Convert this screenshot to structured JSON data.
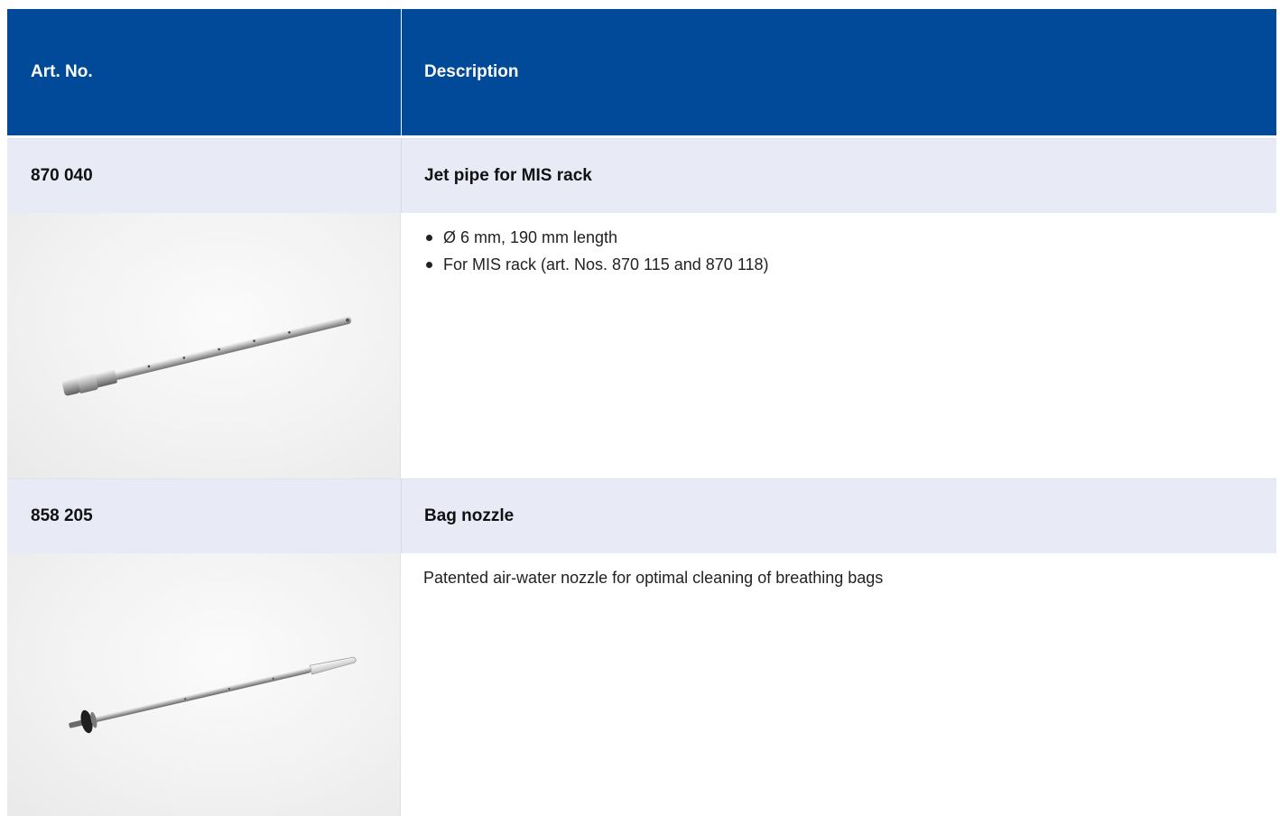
{
  "header": {
    "col_art": "Art. No.",
    "col_desc": "Description"
  },
  "products": [
    {
      "art_no": "870 040",
      "title": "Jet pipe for MIS rack",
      "bullets": [
        "Ø 6 mm, 190 mm length",
        "For MIS rack (art. Nos. 870 115 and 870 118)"
      ],
      "image": "jet-pipe-photo"
    },
    {
      "art_no": "858 205",
      "title": "Bag nozzle",
      "description": "Patented air-water nozzle for optimal cleaning of breathing bags",
      "image": "bag-nozzle-photo"
    }
  ],
  "colors": {
    "header_bg": "#004a99",
    "header_text": "#ffffff",
    "art_row_bg": "#e8ebf6"
  }
}
